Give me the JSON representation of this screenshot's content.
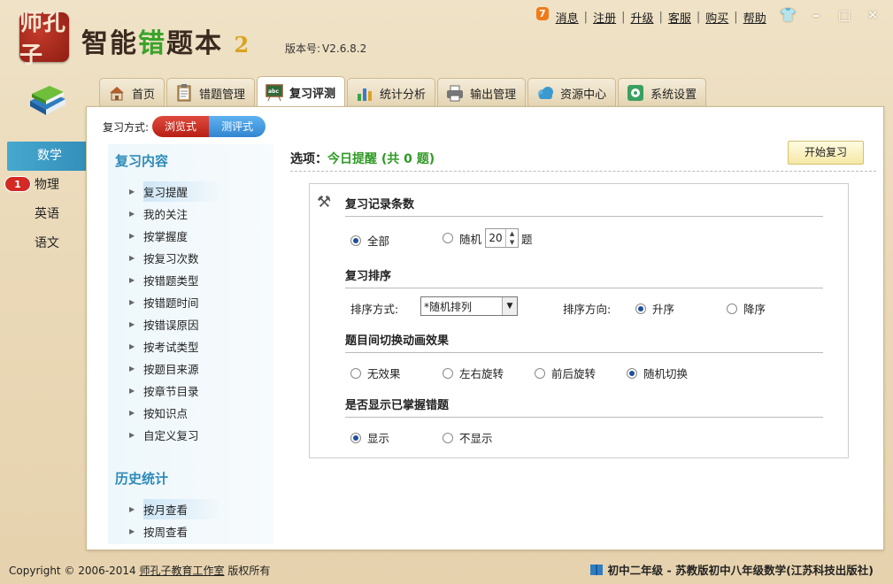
{
  "app": {
    "logo_text": "师孔子",
    "name_parts": [
      "智能",
      "错",
      "题本",
      "2"
    ],
    "version_label": "版本号:",
    "version": "V2.6.8.2"
  },
  "top_links": {
    "badge": "7",
    "items": [
      "消息",
      "注册",
      "升级",
      "客服",
      "购买",
      "帮助"
    ]
  },
  "subjects": [
    {
      "label": "数学",
      "active": true
    },
    {
      "label": "物理",
      "badge": "1"
    },
    {
      "label": "英语"
    },
    {
      "label": "语文"
    }
  ],
  "tabs": [
    {
      "label": "首页",
      "icon": "home-icon",
      "color": "#b5602a"
    },
    {
      "label": "错题管理",
      "icon": "clipboard-icon",
      "color": "#7a6a50"
    },
    {
      "label": "复习评测",
      "icon": "chalkboard-icon",
      "color": "#2f7a3a",
      "active": true
    },
    {
      "label": "统计分析",
      "icon": "bar-chart-icon",
      "color": "#3a7ad0"
    },
    {
      "label": "输出管理",
      "icon": "printer-icon",
      "color": "#555555"
    },
    {
      "label": "资源中心",
      "icon": "cloud-icon",
      "color": "#3a9ad0"
    },
    {
      "label": "系统设置",
      "icon": "settings-icon",
      "color": "#3aa060"
    }
  ],
  "mode": {
    "label": "复习方式:",
    "browse": "浏览式",
    "test": "测评式"
  },
  "nav": {
    "head1": "复习内容",
    "items": [
      "复习提醒",
      "我的关注",
      "按掌握度",
      "按复习次数",
      "按错题类型",
      "按错题时间",
      "按错误原因",
      "按考试类型",
      "按题目来源",
      "按章节目录",
      "按知识点",
      "自定义复习"
    ],
    "head2": "历史统计",
    "items2": [
      "按月查看",
      "按周查看"
    ]
  },
  "options": {
    "prefix": "选项：",
    "title": "今日提醒 (共 0 题)",
    "start_button": "开始复习"
  },
  "settings": {
    "count_title": "复习记录条数",
    "all": "全部",
    "random": "随机",
    "random_value": "20",
    "unit": "题",
    "order_title": "复习排序",
    "order_method_label": "排序方式:",
    "order_method_value": "*随机排列",
    "order_dir_label": "排序方向:",
    "asc": "升序",
    "desc": "降序",
    "anim_title": "题目间切换动画效果",
    "anim_none": "无效果",
    "anim_lr": "左右旋转",
    "anim_fb": "前后旋转",
    "anim_random": "随机切换",
    "show_title": "是否显示已掌握错题",
    "show": "显示",
    "hide": "不显示"
  },
  "footer": {
    "copyright": "Copyright © 2006-2014",
    "studio": "师孔子教育工作室",
    "rights": "版权所有",
    "book": "初中二年级 - 苏教版初中八年级数学(江苏科技出版社)"
  }
}
